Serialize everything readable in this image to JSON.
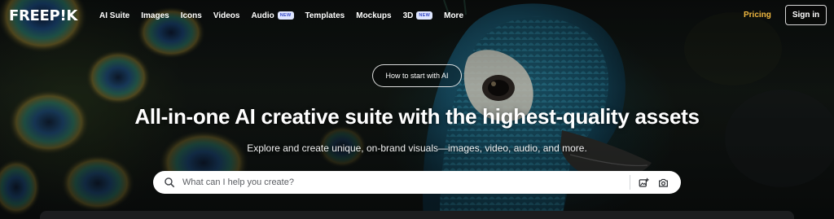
{
  "nav": {
    "logo": "FREEP!K",
    "items": [
      {
        "label": "AI Suite"
      },
      {
        "label": "Images"
      },
      {
        "label": "Icons"
      },
      {
        "label": "Videos"
      },
      {
        "label": "Audio",
        "badge": "NEW"
      },
      {
        "label": "Templates"
      },
      {
        "label": "Mockups"
      },
      {
        "label": "3D",
        "badge": "NEW"
      },
      {
        "label": "More"
      }
    ],
    "pricing": "Pricing",
    "sign_in": "Sign in"
  },
  "hero": {
    "pill": "How to start with AI",
    "headline": "All-in-one AI creative suite with the highest-quality assets",
    "subline": "Explore and create unique, on-brand visuals—images, video, audio, and more."
  },
  "search": {
    "placeholder": "What can I help you create?",
    "value": "",
    "icons": [
      "search-icon",
      "image-upload-icon",
      "camera-icon"
    ]
  },
  "colors": {
    "pricing": "#f1b940",
    "badge_bg": "#dfe6ff",
    "badge_text": "#3549c7",
    "background": "#0b0d0e"
  }
}
